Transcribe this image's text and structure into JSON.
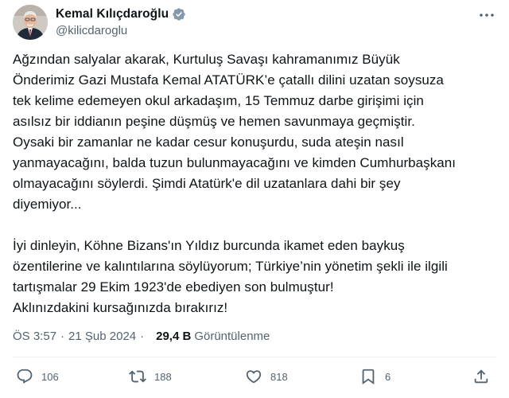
{
  "author": {
    "display_name": "Kemal Kılıçdaroğlu",
    "handle": "@kilicdaroglu",
    "verified_icon": "verified-badge-icon",
    "avatar": "profile-photo"
  },
  "tweet": {
    "lines_p1": [
      "Ağzından salyalar akarak, Kurtuluş Savaşı kahramanımız Büyük",
      "Önderimiz Gazi Mustafa Kemal ATATÜRK’e çatallı dilini uzatan soysuza",
      "tek kelime edemeyen okul arkadaşım, 15 Temmuz darbe girişimi için",
      "asılsız bir iddianın peşine düşmüş ve hemen savunmaya geçmiştir.",
      "Oysaki bir zamanlar ne kadar cesur konuşurdu, suda ateşin nasıl",
      "yanmayacağını, balda tuzun bulunmayacağını ve kimden Cumhurbaşkanı",
      "olmayacağını söylerdi. Şimdi Atatürk'e dil uzatanlara dahi bir şey",
      "diyemiyor..."
    ],
    "lines_p2": [
      "İyi dinleyin, Köhne Bizans'ın Yıldız burcunda ikamet eden baykuş",
      "özentilerine ve kalıntılarına söylüyorum; Türkiye’nin yönetim şekli ile ilgili",
      "tartışmalar 29 Ekim 1923'de ebediyen son bulmuştur!",
      "Aklınızdakini kursağınızda bırakırız!"
    ]
  },
  "meta": {
    "time": "ÖS 3:57",
    "separator": "·",
    "date": "21 Şub 2024",
    "views_count": "29,4 B",
    "views_label": "Görüntülenme"
  },
  "actions": {
    "replies": "106",
    "reposts": "188",
    "likes": "818",
    "bookmarks": "6"
  },
  "colors": {
    "text": "#0f1419",
    "secondary": "#536471",
    "verified": "#829aab",
    "divider": "#eff3f4"
  }
}
